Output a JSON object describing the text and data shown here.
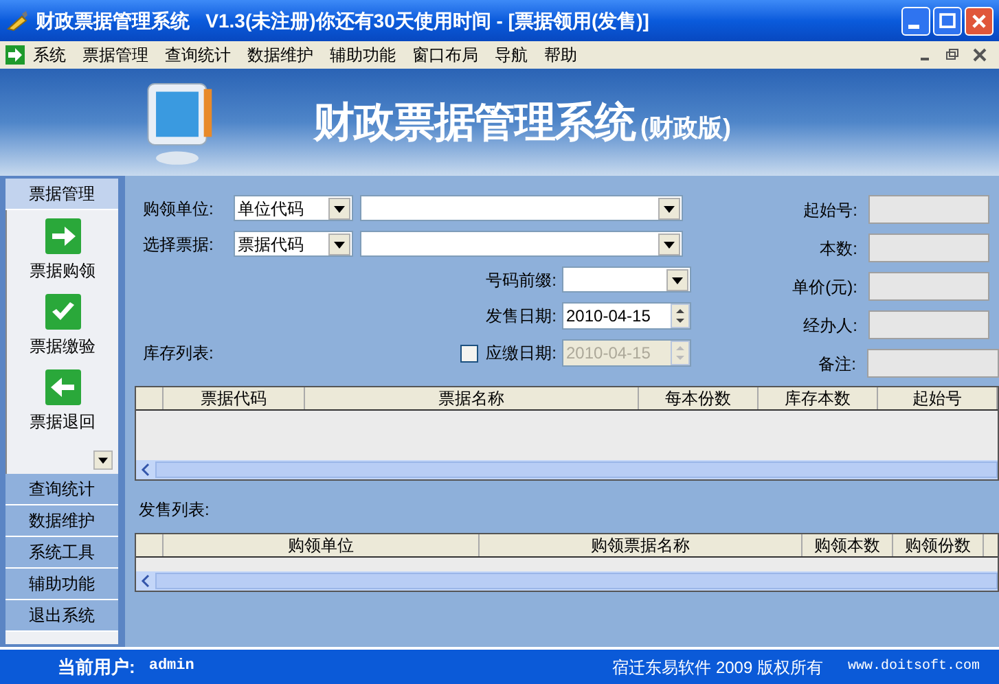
{
  "window": {
    "title": "财政票据管理系统   V1.3(未注册)你还有30天使用时间 - [票据领用(发售)]"
  },
  "menu": [
    "系统",
    "票据管理",
    "查询统计",
    "数据维护",
    "辅助功能",
    "窗口布局",
    "导航",
    "帮助"
  ],
  "banner": {
    "title": "财政票据管理系统",
    "subtitle": "(财政版)"
  },
  "sidebar": {
    "sections": [
      {
        "label": "票据管理",
        "selected": true,
        "items": [
          {
            "label": "票据购领",
            "kind": "forward"
          },
          {
            "label": "票据缴验",
            "kind": "check"
          },
          {
            "label": "票据退回",
            "kind": "back"
          }
        ]
      },
      {
        "label": "查询统计",
        "selected": false
      },
      {
        "label": "数据维护",
        "selected": false
      },
      {
        "label": "系统工具",
        "selected": false
      },
      {
        "label": "辅助功能",
        "selected": false
      },
      {
        "label": "退出系统",
        "selected": false
      }
    ]
  },
  "form": {
    "unit": {
      "label": "购领单位:",
      "select": "单位代码"
    },
    "ticket": {
      "label": "选择票据:",
      "select": "票据代码"
    },
    "prefix": {
      "label": "号码前缀:"
    },
    "sale_date": {
      "label": "发售日期:",
      "value": "2010-04-15",
      "disabled": false
    },
    "due_date": {
      "label": "应缴日期:",
      "value": "2010-04-15",
      "disabled": true,
      "checked": false
    },
    "stock_label": "库存列表:",
    "right_fields": [
      "起始号:",
      "本数:",
      "单价(元):",
      "经办人:",
      "备注:"
    ]
  },
  "stock_table": {
    "columns": [
      "票据代码",
      "票据名称",
      "每本份数",
      "库存本数",
      "起始号"
    ]
  },
  "sales_label": "发售列表:",
  "sales_table": {
    "columns": [
      "购领单位",
      "购领票据名称",
      "购领本数",
      "购领份数"
    ]
  },
  "status_bar": {
    "user_label": "当前用户:",
    "user": "admin",
    "copyright": "宿迁东易软件 2009 版权所有",
    "website": "www.doitsoft.com"
  }
}
